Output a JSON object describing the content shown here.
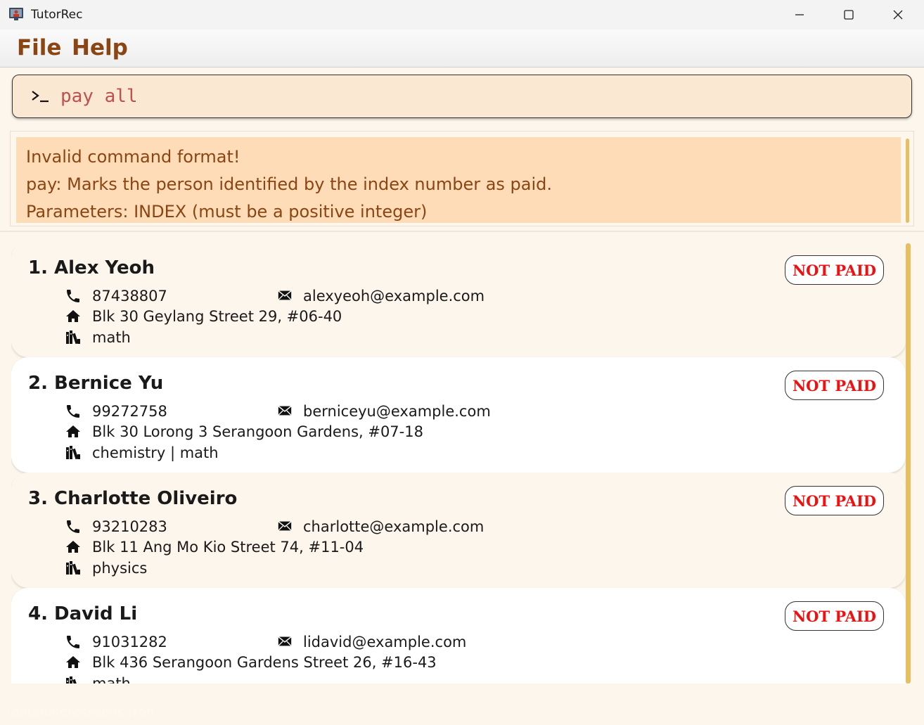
{
  "window": {
    "title": "TutorRec",
    "icon": "tutor-app-icon",
    "controls": [
      "minimize",
      "maximize",
      "close"
    ]
  },
  "menu": {
    "file": "File",
    "help": "Help"
  },
  "command": {
    "prompt_icon": "terminal-prompt-icon",
    "value": "pay all"
  },
  "result": {
    "line1": "Invalid command format!",
    "line2": "pay: Marks the person identified by the index number as paid.",
    "line3": "Parameters: INDEX (must be a positive integer)"
  },
  "persons": [
    {
      "name": "1. Alex Yeoh",
      "status": "NOT PAID",
      "phone": "87438807",
      "email": "alexyeoh@example.com",
      "address": "Blk 30 Geylang Street 29, #06-40",
      "subjects": "math"
    },
    {
      "name": "2. Bernice Yu",
      "status": "NOT PAID",
      "phone": "99272758",
      "email": "berniceyu@example.com",
      "address": "Blk 30 Lorong 3 Serangoon Gardens, #07-18",
      "subjects": "chemistry | math"
    },
    {
      "name": "3. Charlotte Oliveiro",
      "status": "NOT PAID",
      "phone": "93210283",
      "email": "charlotte@example.com",
      "address": "Blk 11 Ang Mo Kio Street 74, #11-04",
      "subjects": "physics"
    },
    {
      "name": "4. David Li",
      "status": "NOT PAID",
      "phone": "91031282",
      "email": "lidavid@example.com",
      "address": "Blk 436 Serangoon Gardens Street 26, #16-43",
      "subjects": "math"
    }
  ],
  "status_bar": {
    "file_path": ".\\data\\addressbook.json"
  },
  "colors": {
    "accent": "#8b4513",
    "not_paid": "#ee1111",
    "command_bg": "#fbe8d3",
    "result_bg": "#ffdcb8",
    "scrollbar": "#e6c060"
  }
}
